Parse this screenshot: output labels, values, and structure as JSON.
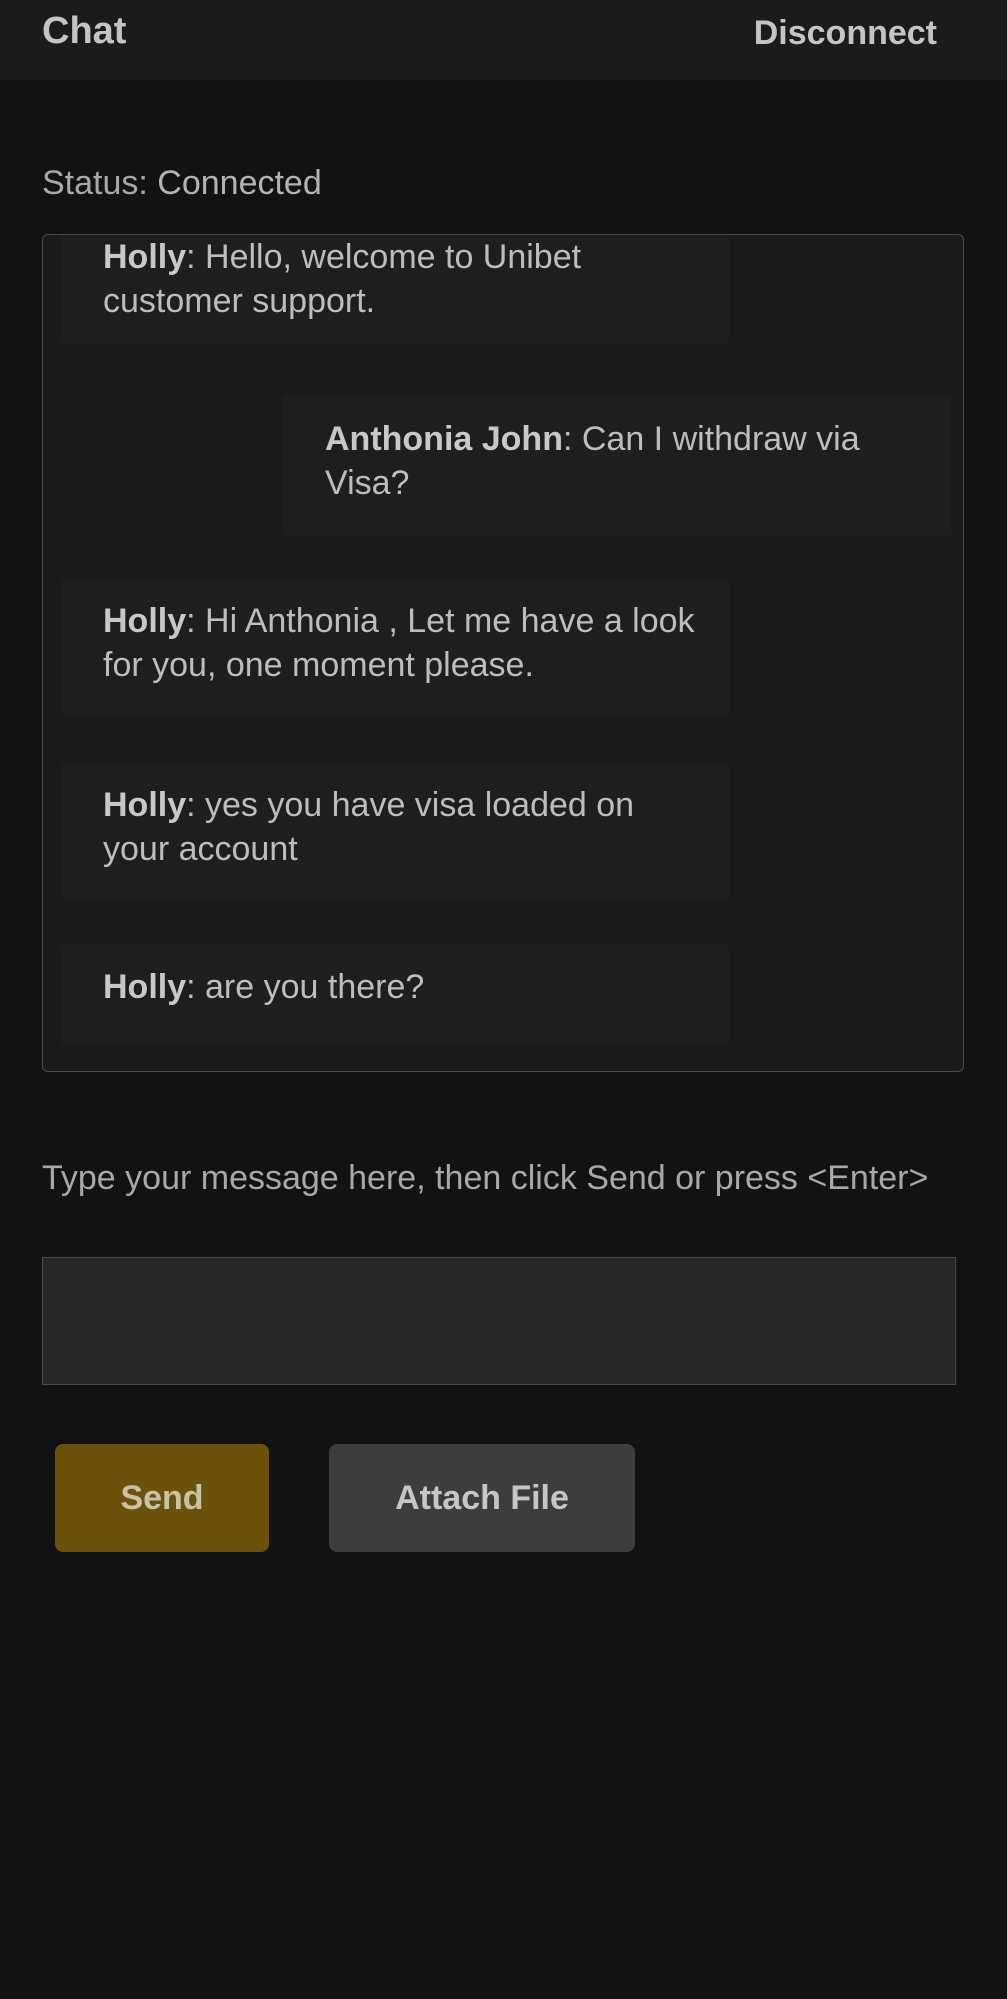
{
  "header": {
    "title": "Chat",
    "disconnect_label": "Disconnect"
  },
  "status": {
    "label": "Status: ",
    "value": "Connected"
  },
  "messages": [
    {
      "author": "Holly",
      "text": ": Hello, welcome to Unibet customer support.",
      "side": "agent"
    },
    {
      "author": "Anthonia John",
      "text": ": Can I withdraw via Visa?",
      "side": "user"
    },
    {
      "author": "Holly",
      "text": ": Hi Anthonia , Let me have a look for you, one moment please.",
      "side": "agent"
    },
    {
      "author": "Holly",
      "text": ": yes you have visa loaded on your account",
      "side": "agent"
    },
    {
      "author": "Holly",
      "text": ": are you there?",
      "side": "agent"
    }
  ],
  "composer": {
    "instructions": "Type your message here, then click Send or press <Enter>",
    "value": "",
    "send_label": "Send",
    "attach_label": "Attach File"
  },
  "colors": {
    "background": "#121212",
    "header": "#1b1b1b",
    "send_button": "#6b5208",
    "attach_button": "#3d3d3d"
  }
}
